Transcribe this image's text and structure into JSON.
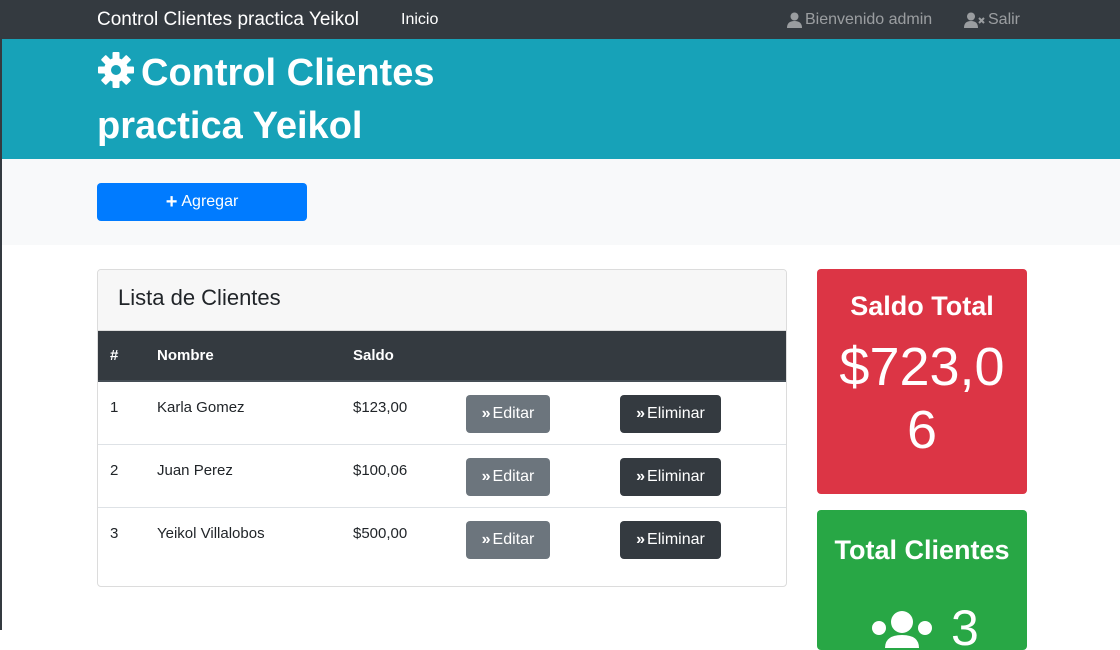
{
  "navbar": {
    "brand": "Control Clientes practica Yeikol",
    "inicio": "Inicio",
    "user": "Bienvenido admin",
    "logout": "Salir"
  },
  "header": {
    "title": "Control Clientes practica Yeikol"
  },
  "actions": {
    "add_label": "Agregar"
  },
  "clientes": {
    "title": "Lista de Clientes",
    "columns": [
      "#",
      "Nombre",
      "Saldo"
    ],
    "rows": [
      {
        "num": "1",
        "nombre": "Karla Gomez",
        "saldo": "$123,00",
        "edit": "Editar",
        "delete": "Eliminar"
      },
      {
        "num": "2",
        "nombre": "Juan Perez",
        "saldo": "$100,06",
        "edit": "Editar",
        "delete": "Eliminar"
      },
      {
        "num": "3",
        "nombre": "Yeikol Villalobos",
        "saldo": "$500,00",
        "edit": "Editar",
        "delete": "Eliminar"
      }
    ]
  },
  "saldo_total": {
    "title": "Saldo Total",
    "value": "$723,06"
  },
  "total_clientes": {
    "title": "Total Clientes",
    "value": "3"
  },
  "colors": {
    "navbar": "#343a40",
    "header": "#17a2b8",
    "primary": "#007bff",
    "danger": "#dc3545",
    "success": "#28a745",
    "secondary": "#6c757d"
  }
}
